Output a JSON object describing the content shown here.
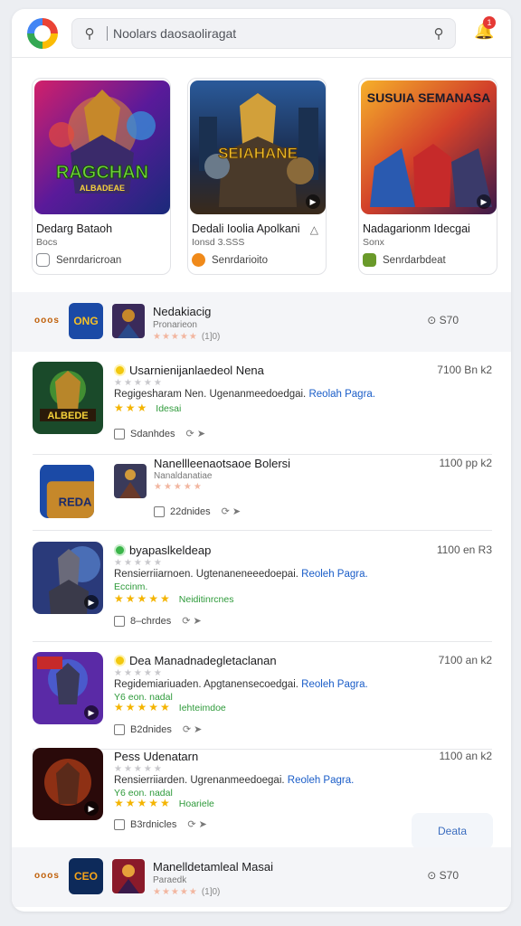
{
  "header": {
    "search_placeholder": "Noolars daosaoliragat",
    "notification_count": "1"
  },
  "featured": [
    {
      "title": "Dedarg Bataoh",
      "subtitle": "Bocs",
      "button": "Senrdaricroan",
      "art_title": "RAGCHAN",
      "art_sub": "ALBADEAE"
    },
    {
      "title": "Dedali Ioolia Apolkani",
      "subtitle": "Ionsd 3.SSS",
      "button": "Senrdarioito",
      "art_title": "SEIAHANE",
      "art_sub": ""
    },
    {
      "title": "Nadagarionm Idecgai",
      "subtitle": "Sonx",
      "button": "Senrdarbdeat",
      "art_title": "SUSUIA SEMANASA",
      "art_sub": ""
    }
  ],
  "ads": [
    {
      "label": "ooos",
      "logo": "ONG",
      "title": "Nedakiacig",
      "sub": "Pronarieon",
      "rating": "(1]0)",
      "price": "⊙ S70"
    },
    {
      "label": "ooos",
      "logo": "CEO",
      "title": "Manelldetamleal Masai",
      "sub": "Paraedk",
      "rating": "(1]0)",
      "price": "⊙ S70"
    }
  ],
  "list": [
    {
      "title": "Usarnienijanlaedeol Nena",
      "meta": "7100 Bn k2",
      "desc": "Regigesharam Nen. Ugenanmeedoedgai.",
      "link": "Reolah Pagra.",
      "extra": "Idesai",
      "downloads": "Sdanhdes",
      "ystars": "★★★"
    },
    {
      "title": "Nanellleenaotsaoe Bolersi",
      "meta": "1100 pp k2",
      "sub": "Nanaldanatiae",
      "downloads": "22dnides"
    },
    {
      "title": "byapaslkeldeap",
      "meta": "1100 en R3",
      "desc": "Rensierriiarnoen. Ugtenaneneeedoepai.",
      "link": "Reoleh Pagra.",
      "extra": "Eccinm.",
      "ystar_label": "Neiditinrcnes",
      "downloads": "8‒chrdes"
    },
    {
      "title": "Dea Manadnadegletaclanan",
      "meta": "7100 an k2",
      "desc": "Regidemiariuaden. Apgtanensecoedgai.",
      "link": "Reoleh Pagra.",
      "extra": "Y6 eon. nadal",
      "ystar_label": "Iehteimdoe",
      "downloads": "B2dnides"
    },
    {
      "title": "Pess Udenatarn",
      "meta": "1100 an k2",
      "desc": "Rensierriiarden. Ugrenanmeedoegai.",
      "link": "Reoleh Pagra.",
      "extra": "Y6 eon. nadal",
      "ystar_label": "Hoariele",
      "downloads": "B3rdnicles"
    }
  ],
  "show_more": "Deata"
}
